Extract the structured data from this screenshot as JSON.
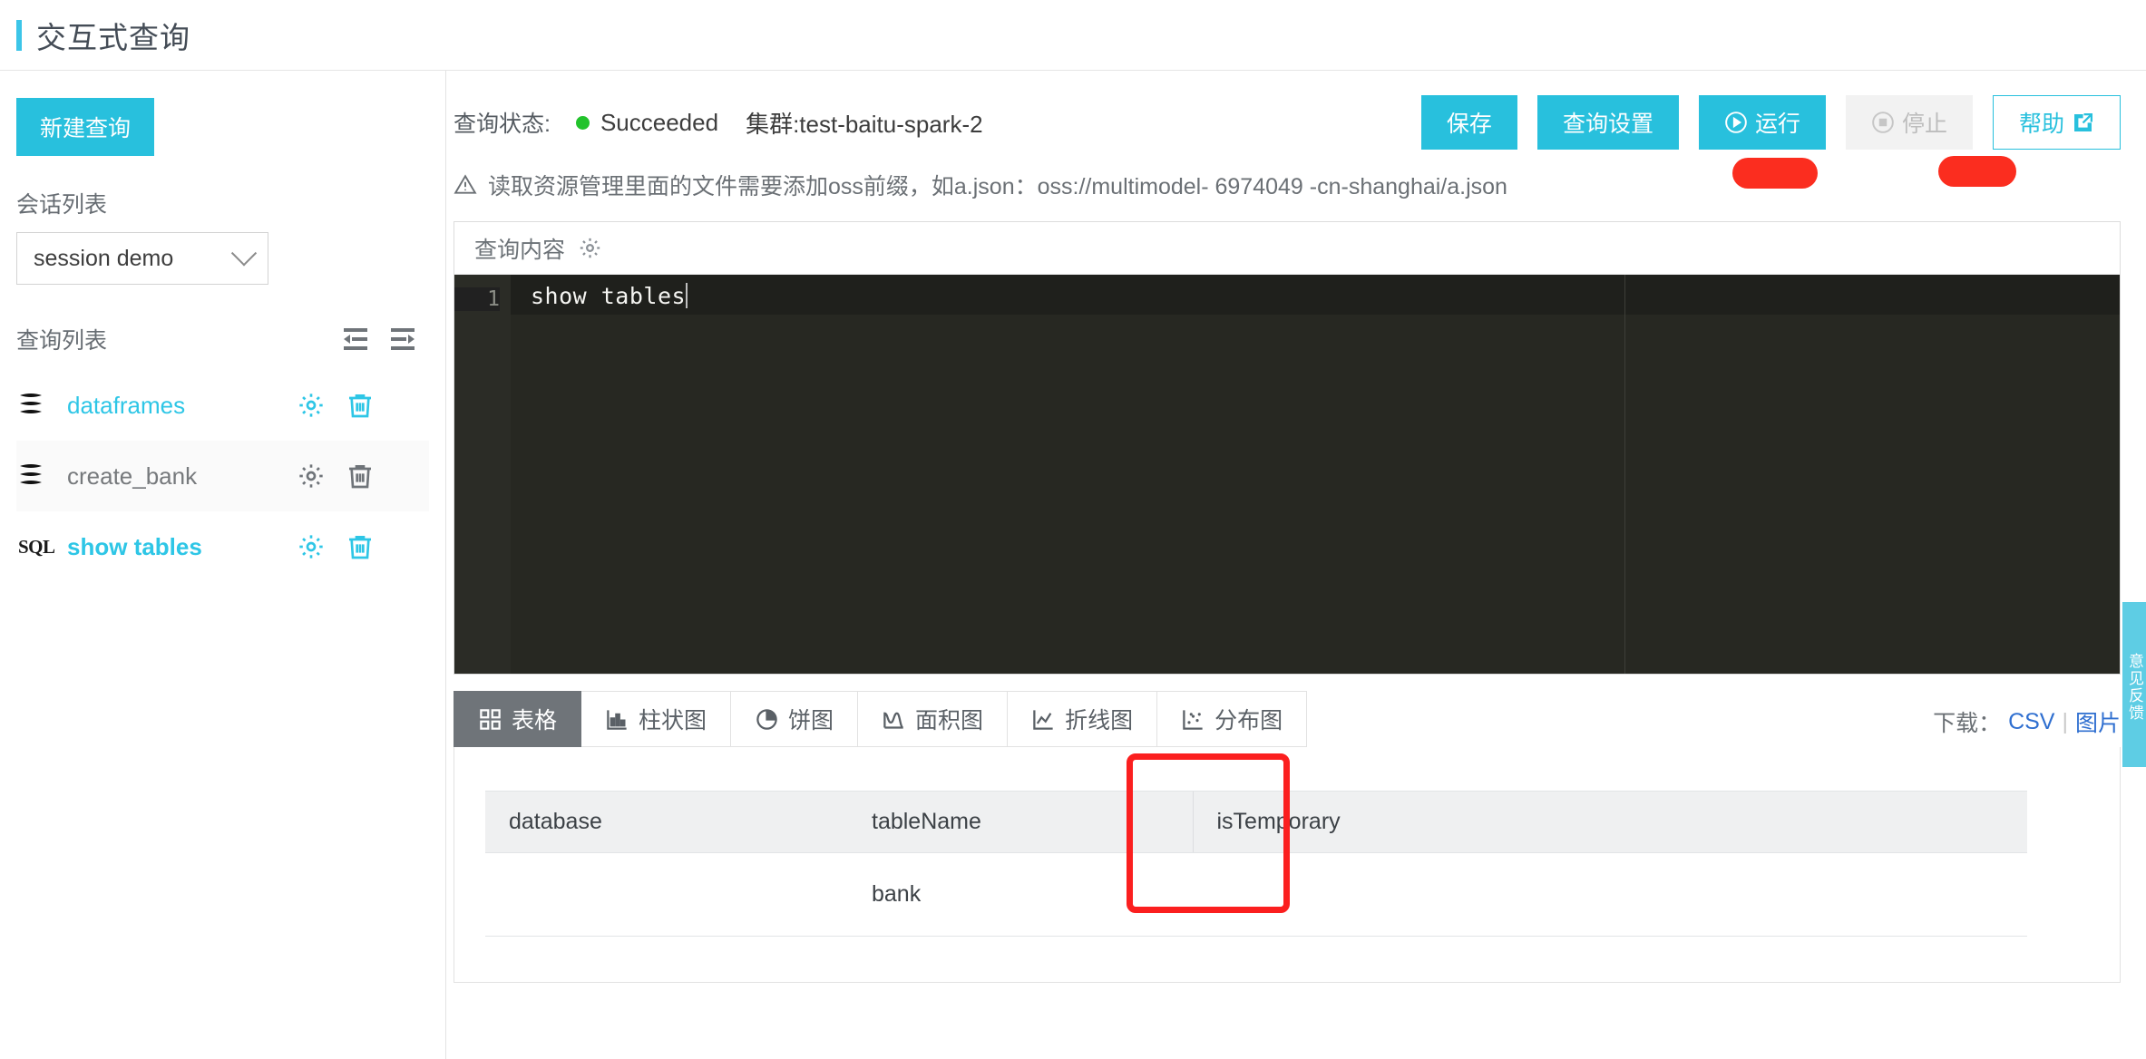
{
  "header": {
    "title": "交互式查询"
  },
  "sidebar": {
    "new_query_label": "新建查询",
    "session_section_label": "会话列表",
    "session_value": "session demo",
    "query_section_label": "查询列表",
    "collapse_all_icon": "indent-left-icon",
    "expand_all_icon": "indent-right-icon",
    "queries": [
      {
        "name": "dataframes",
        "type": "notebook",
        "type_badge": "",
        "state": "selected"
      },
      {
        "name": "create_bank",
        "type": "notebook",
        "type_badge": "",
        "state": "normal"
      },
      {
        "name": "show tables",
        "type": "sql",
        "type_badge": "SQL",
        "state": "active"
      }
    ],
    "row_settings_label": "设置",
    "row_delete_label": "删除"
  },
  "toolbar": {
    "status_label": "查询状态:",
    "status_value": "Succeeded",
    "status_color": "#22c32c",
    "cluster": "集群:test-baitu-spark-2",
    "save_label": "保存",
    "query_settings_label": "查询设置",
    "run_label": "运行",
    "stop_label": "停止",
    "help_label": "帮助"
  },
  "warning": {
    "text": "读取资源管理里面的文件需要添加oss前缀，如a.json：oss://multimodel-          6974049         -cn-shanghai/a.json"
  },
  "editor": {
    "panel_title": "查询内容",
    "settings_icon": "gear-icon",
    "line_number": "1",
    "code": "show tables"
  },
  "results": {
    "tabs": [
      {
        "label": "表格",
        "icon": "table-icon",
        "active": true
      },
      {
        "label": "柱状图",
        "icon": "bar-chart-icon",
        "active": false
      },
      {
        "label": "饼图",
        "icon": "pie-chart-icon",
        "active": false
      },
      {
        "label": "面积图",
        "icon": "area-chart-icon",
        "active": false
      },
      {
        "label": "折线图",
        "icon": "line-chart-icon",
        "active": false
      },
      {
        "label": "分布图",
        "icon": "scatter-chart-icon",
        "active": false
      }
    ],
    "download_label": "下载：",
    "download_csv": "CSV",
    "download_sep": "|",
    "download_image": "图片",
    "table": {
      "columns": [
        "database",
        "tableName",
        "isTemporary"
      ],
      "rows": [
        [
          "",
          "bank",
          ""
        ]
      ],
      "highlight_column": "tableName",
      "highlight_color": "#fb1f1f"
    }
  },
  "side_tab": {
    "label": "意见反馈"
  },
  "colors": {
    "accent": "#28c0dd",
    "accent_light": "#3cc5e8",
    "link": "#2f6fd0",
    "tab_active_bg": "#6f7479",
    "editor_bg": "#272822",
    "success": "#22c32c",
    "highlight": "#fb1f1f"
  }
}
